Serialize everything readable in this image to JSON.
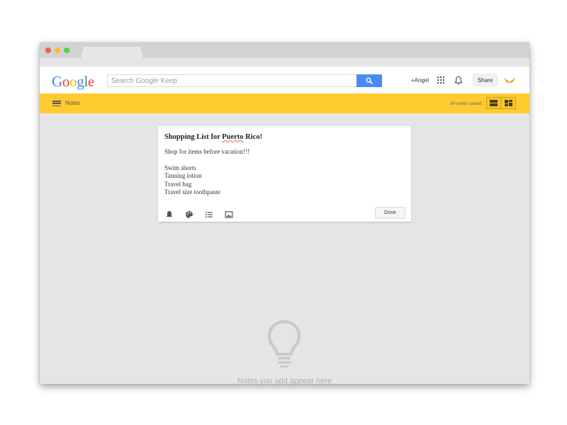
{
  "browser": {
    "controls": [
      "close",
      "minimize",
      "maximize"
    ]
  },
  "header": {
    "logo": [
      "G",
      "o",
      "o",
      "g",
      "l",
      "e"
    ],
    "search_placeholder": "Search Google Keep",
    "search_icon": "search-icon",
    "user_link": "+Angel",
    "apps_icon": "apps-grid-icon",
    "notifications_icon": "bell-icon",
    "share_label": "Share",
    "avatar_icon": "wings-avatar-icon"
  },
  "toolbar": {
    "menu_icon": "hamburger-menu-icon",
    "section_label": "Notes",
    "save_status": "All notes saved",
    "view_list_icon": "list-view-icon",
    "view_grid_icon": "grid-view-icon"
  },
  "note": {
    "title_prefix": "Shopping List for ",
    "title_underlined": "Puerto",
    "title_suffix": " Rico!",
    "lines": [
      "Shop for items before vacation!!!",
      "",
      "Swim shorts",
      "Tanning lotion",
      "Travel bag",
      "Travel size toothpaste"
    ],
    "actions": [
      "reminder-icon",
      "palette-icon",
      "checklist-icon",
      "image-icon"
    ],
    "done_label": "Done"
  },
  "empty_state": {
    "icon": "lightbulb-icon",
    "message": "Notes you add appear here"
  },
  "colors": {
    "toolbar": "#ffcb2f",
    "search_button": "#4a8af4",
    "background": "#e5e5e5"
  }
}
